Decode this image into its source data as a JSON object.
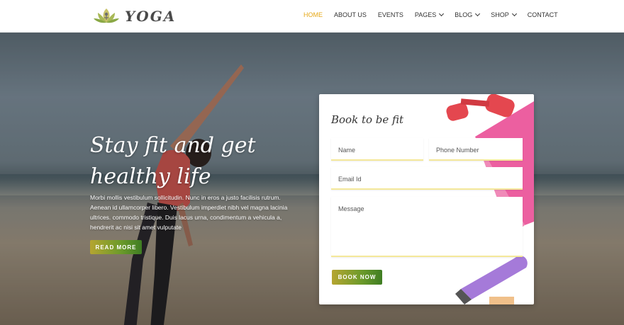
{
  "header": {
    "logo_text": "YOGA",
    "nav": [
      {
        "label": "HOME",
        "active": true,
        "dropdown": false
      },
      {
        "label": "ABOUT US",
        "active": false,
        "dropdown": false
      },
      {
        "label": "EVENTS",
        "active": false,
        "dropdown": false
      },
      {
        "label": "PAGES",
        "active": false,
        "dropdown": true
      },
      {
        "label": "BLOG",
        "active": false,
        "dropdown": true
      },
      {
        "label": "SHOP",
        "active": false,
        "dropdown": true
      },
      {
        "label": "CONTACT",
        "active": false,
        "dropdown": false
      }
    ]
  },
  "hero": {
    "title_line1": "Stay fit and get",
    "title_line2": "healthy life",
    "text": "Morbi mollis vestibulum sollicitudin. Nunc in eros a justo facilisis rutrum. Aenean id ullamcorper libero. Vestibulum imperdiet nibh vel magna lacinia ultrices. commodo tristique. Duis lacus urna, condimentum a vehicula a, hendrerit ac nisi sit amet vulputate",
    "button_label": "READ MORE"
  },
  "booking": {
    "title": "Book to be fit",
    "name_placeholder": "Name",
    "phone_placeholder": "Phone Number",
    "email_placeholder": "Email Id",
    "message_placeholder": "Message",
    "button_label": "BOOK NOW"
  },
  "colors": {
    "accent": "#e6a817",
    "button_start": "#b5a531",
    "button_end": "#3f7d23",
    "field_border": "#f4e89a"
  }
}
